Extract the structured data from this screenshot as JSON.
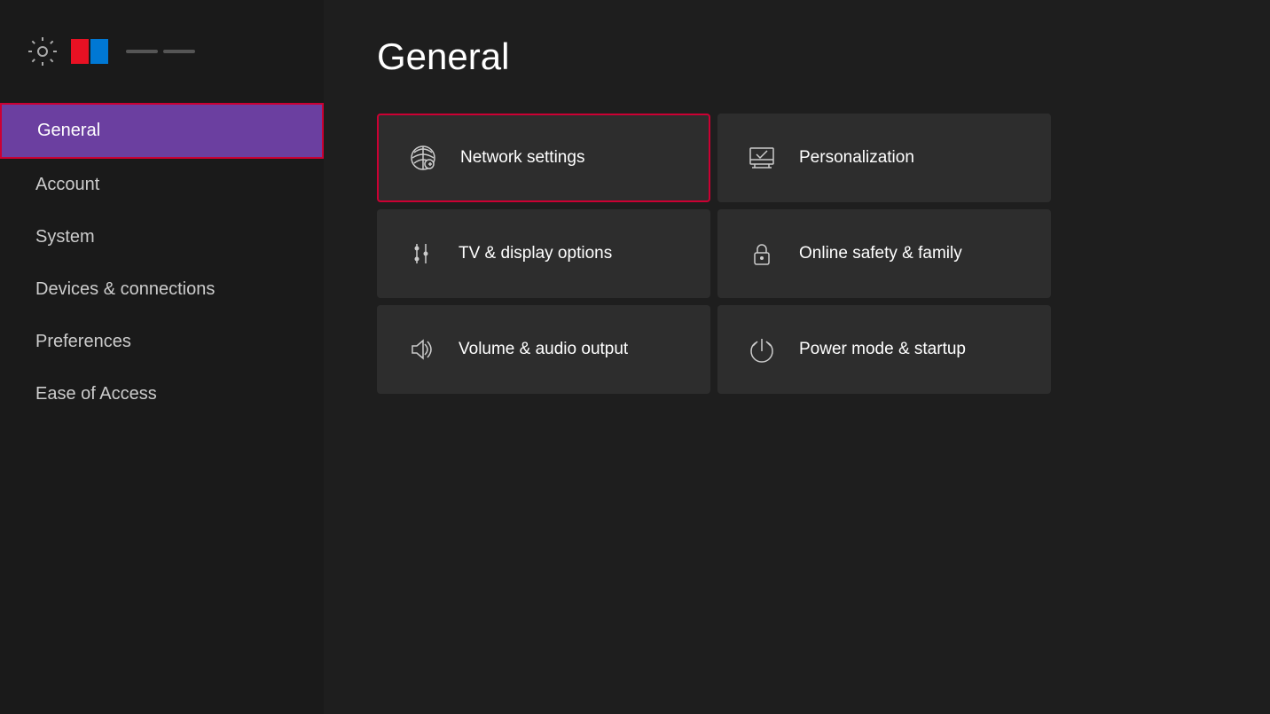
{
  "page": {
    "title": "General"
  },
  "sidebar": {
    "items": [
      {
        "id": "general",
        "label": "General",
        "active": true
      },
      {
        "id": "account",
        "label": "Account",
        "active": false
      },
      {
        "id": "system",
        "label": "System",
        "active": false
      },
      {
        "id": "devices-connections",
        "label": "Devices & connections",
        "active": false
      },
      {
        "id": "preferences",
        "label": "Preferences",
        "active": false
      },
      {
        "id": "ease-of-access",
        "label": "Ease of Access",
        "active": false
      }
    ]
  },
  "settings_tiles": [
    {
      "id": "network-settings",
      "label": "Network settings",
      "icon": "network",
      "highlighted": true
    },
    {
      "id": "personalization",
      "label": "Personalization",
      "icon": "personalization",
      "highlighted": false
    },
    {
      "id": "tv-display",
      "label": "TV & display options",
      "icon": "display",
      "highlighted": false
    },
    {
      "id": "online-safety",
      "label": "Online safety & family",
      "icon": "lock",
      "highlighted": false
    },
    {
      "id": "volume-audio",
      "label": "Volume & audio output",
      "icon": "volume",
      "highlighted": false
    },
    {
      "id": "power-mode",
      "label": "Power mode & startup",
      "icon": "power",
      "highlighted": false
    }
  ]
}
